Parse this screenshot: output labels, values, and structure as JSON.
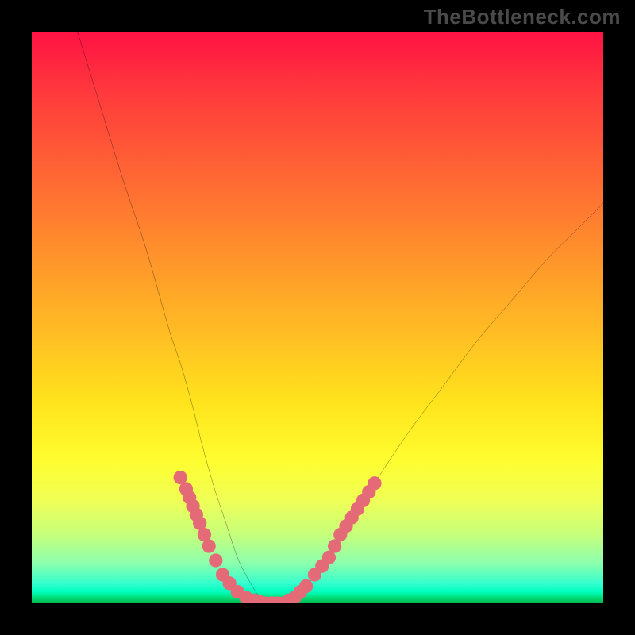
{
  "watermark": "TheBottleneck.com",
  "chart_data": {
    "type": "line",
    "title": "",
    "xlabel": "",
    "ylabel": "",
    "xlim": [
      0,
      100
    ],
    "ylim": [
      0,
      100
    ],
    "grid": false,
    "legend": false,
    "series": [
      {
        "name": "bottleneck-curve",
        "color": "#000000",
        "x": [
          8,
          12,
          16,
          20,
          24,
          26,
          28,
          30,
          32,
          34,
          36,
          38,
          40,
          42,
          44,
          46,
          48,
          52,
          56,
          60,
          66,
          72,
          78,
          84,
          90,
          96,
          100
        ],
        "y": [
          100,
          87,
          74,
          62,
          48,
          42,
          35,
          27,
          20,
          14,
          8,
          4,
          1,
          0,
          0,
          1,
          3,
          8,
          14,
          21,
          30,
          38,
          46,
          53,
          60,
          66,
          70
        ]
      }
    ],
    "markers": [
      {
        "name": "left-arm-markers",
        "color": "#e46a77",
        "radius": 1.2,
        "points": [
          {
            "x": 26.0,
            "y": 22.0
          },
          {
            "x": 27.0,
            "y": 20.0
          },
          {
            "x": 27.6,
            "y": 18.5
          },
          {
            "x": 28.2,
            "y": 17.0
          },
          {
            "x": 28.8,
            "y": 15.5
          },
          {
            "x": 29.4,
            "y": 14.0
          },
          {
            "x": 30.2,
            "y": 12.0
          },
          {
            "x": 31.0,
            "y": 10.0
          },
          {
            "x": 32.2,
            "y": 7.5
          },
          {
            "x": 33.4,
            "y": 5.0
          },
          {
            "x": 34.6,
            "y": 3.5
          },
          {
            "x": 36.0,
            "y": 2.0
          },
          {
            "x": 37.5,
            "y": 1.0
          },
          {
            "x": 39.0,
            "y": 0.5
          },
          {
            "x": 40.0,
            "y": 0.2
          },
          {
            "x": 41.0,
            "y": 0.0
          },
          {
            "x": 42.0,
            "y": 0.0
          },
          {
            "x": 43.0,
            "y": 0.0
          }
        ]
      },
      {
        "name": "right-arm-markers",
        "color": "#e46a77",
        "radius": 1.2,
        "points": [
          {
            "x": 44.0,
            "y": 0.0
          },
          {
            "x": 45.0,
            "y": 0.5
          },
          {
            "x": 46.0,
            "y": 1.0
          },
          {
            "x": 47.0,
            "y": 2.0
          },
          {
            "x": 48.0,
            "y": 3.0
          },
          {
            "x": 49.5,
            "y": 5.0
          },
          {
            "x": 50.8,
            "y": 6.5
          },
          {
            "x": 52.0,
            "y": 8.0
          },
          {
            "x": 53.0,
            "y": 10.0
          },
          {
            "x": 54.0,
            "y": 12.0
          },
          {
            "x": 55.0,
            "y": 13.5
          },
          {
            "x": 56.0,
            "y": 15.0
          },
          {
            "x": 57.0,
            "y": 16.5
          },
          {
            "x": 58.0,
            "y": 18.0
          },
          {
            "x": 59.0,
            "y": 19.5
          },
          {
            "x": 60.0,
            "y": 21.0
          }
        ]
      }
    ]
  }
}
